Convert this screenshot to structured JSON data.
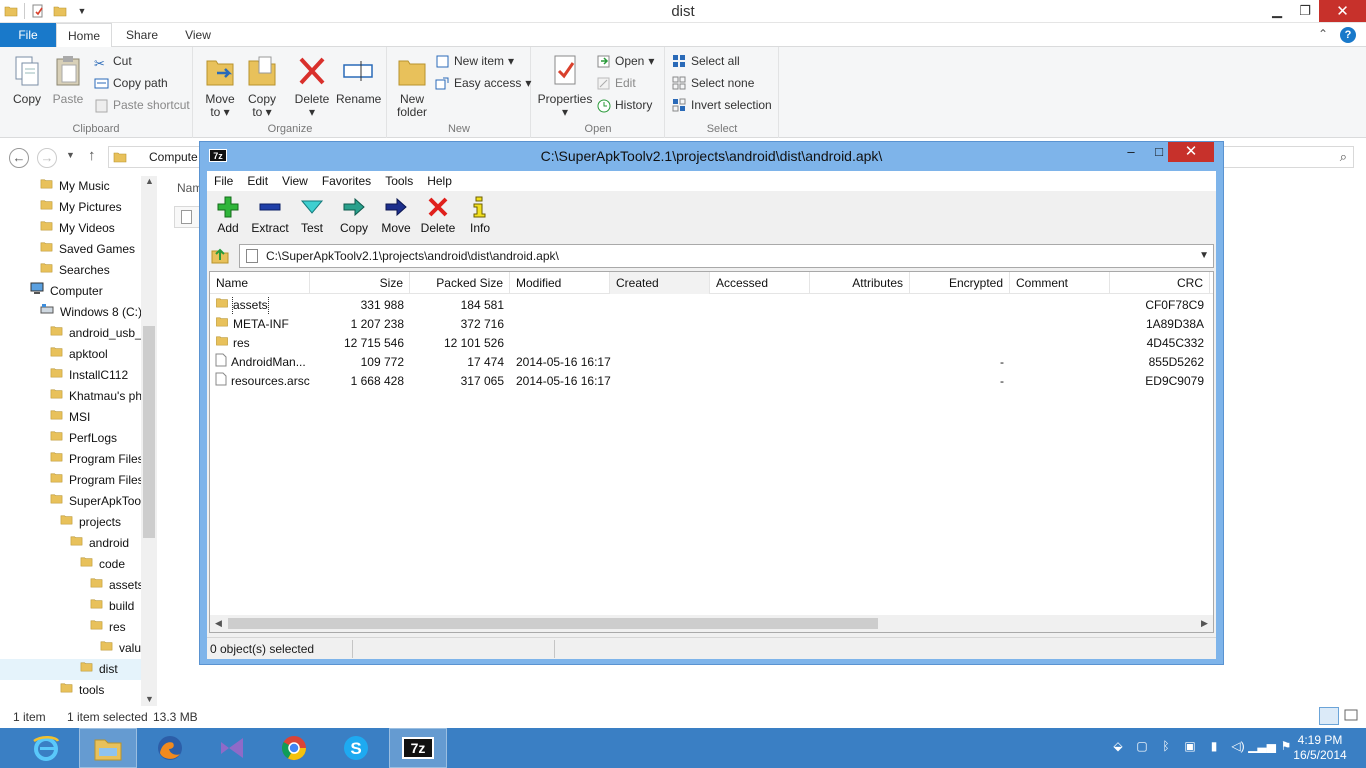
{
  "explorer": {
    "title": "dist",
    "tabs": [
      "File",
      "Home",
      "Share",
      "View"
    ],
    "clipboard": {
      "copy": "Copy",
      "paste": "Paste",
      "cut": "Cut",
      "copy_path": "Copy path",
      "paste_shortcut": "Paste shortcut",
      "label": "Clipboard"
    },
    "organize": {
      "move_to": "Move",
      "move_to_2": "to",
      "copy_to": "Copy",
      "copy_to_2": "to",
      "delete": "Delete",
      "rename": "Rename",
      "label": "Organize"
    },
    "new": {
      "new_folder": "New",
      "new_folder_2": "folder",
      "new_item": "New item",
      "easy_access": "Easy access",
      "label": "New"
    },
    "open": {
      "properties": "Properties",
      "open": "Open",
      "edit": "Edit",
      "history": "History",
      "label": "Open"
    },
    "select": {
      "select_all": "Select all",
      "select_none": "Select none",
      "invert": "Invert selection",
      "label": "Select"
    },
    "address_text": "Compute",
    "column_name": "Nam",
    "tree": [
      {
        "label": "My Music",
        "level": 2
      },
      {
        "label": "My Pictures",
        "level": 2
      },
      {
        "label": "My Videos",
        "level": 2
      },
      {
        "label": "Saved Games",
        "level": 2
      },
      {
        "label": "Searches",
        "level": 2
      },
      {
        "label": "Computer",
        "level": 1
      },
      {
        "label": "Windows 8 (C:)",
        "level": 2
      },
      {
        "label": "android_usb_",
        "level": 3
      },
      {
        "label": "apktool",
        "level": 3
      },
      {
        "label": "InstallC112",
        "level": 3
      },
      {
        "label": "Khatmau's ph",
        "level": 3
      },
      {
        "label": "MSI",
        "level": 3
      },
      {
        "label": "PerfLogs",
        "level": 3
      },
      {
        "label": "Program Files",
        "level": 3
      },
      {
        "label": "Program Files",
        "level": 3
      },
      {
        "label": "SuperApkTool",
        "level": 3
      },
      {
        "label": "projects",
        "level": 4
      },
      {
        "label": "android",
        "level": 5
      },
      {
        "label": "code",
        "level": 6
      },
      {
        "label": "assets",
        "level": 7
      },
      {
        "label": "build",
        "level": 7
      },
      {
        "label": "res",
        "level": 7
      },
      {
        "label": "valu",
        "level": 8
      },
      {
        "label": "dist",
        "level": 6
      },
      {
        "label": "tools",
        "level": 4
      }
    ],
    "status": {
      "items": "1 item",
      "selected": "1 item selected",
      "size": "13.3 MB"
    }
  },
  "sevenzip": {
    "title": "C:\\SuperApkToolv2.1\\projects\\android\\dist\\android.apk\\",
    "logo": "7z",
    "menu": [
      "File",
      "Edit",
      "View",
      "Favorites",
      "Tools",
      "Help"
    ],
    "toolbar": [
      "Add",
      "Extract",
      "Test",
      "Copy",
      "Move",
      "Delete",
      "Info"
    ],
    "path": "C:\\SuperApkToolv2.1\\projects\\android\\dist\\android.apk\\",
    "columns": [
      "Name",
      "Size",
      "Packed Size",
      "Modified",
      "Created",
      "Accessed",
      "Attributes",
      "Encrypted",
      "Comment",
      "CRC"
    ],
    "rows": [
      {
        "name": "assets",
        "type": "folder",
        "size": "331 988",
        "packed": "184 581",
        "modified": "",
        "encrypted": "",
        "crc": "CF0F78C9"
      },
      {
        "name": "META-INF",
        "type": "folder",
        "size": "1 207 238",
        "packed": "372 716",
        "modified": "",
        "encrypted": "",
        "crc": "1A89D38A"
      },
      {
        "name": "res",
        "type": "folder",
        "size": "12 715 546",
        "packed": "12 101 526",
        "modified": "",
        "encrypted": "",
        "crc": "4D45C332"
      },
      {
        "name": "AndroidMan...",
        "type": "file",
        "size": "109 772",
        "packed": "17 474",
        "modified": "2014-05-16 16:17",
        "encrypted": "-",
        "crc": "855D5262"
      },
      {
        "name": "resources.arsc",
        "type": "file",
        "size": "1 668 428",
        "packed": "317 065",
        "modified": "2014-05-16 16:17",
        "encrypted": "-",
        "crc": "ED9C9079"
      }
    ],
    "status": "0 object(s) selected"
  },
  "taskbar": {
    "time": "4:19 PM",
    "date": "16/5/2014",
    "apps": [
      "internet-explorer",
      "file-explorer",
      "firefox",
      "visual-studio",
      "chrome",
      "skype",
      "7-zip"
    ]
  }
}
